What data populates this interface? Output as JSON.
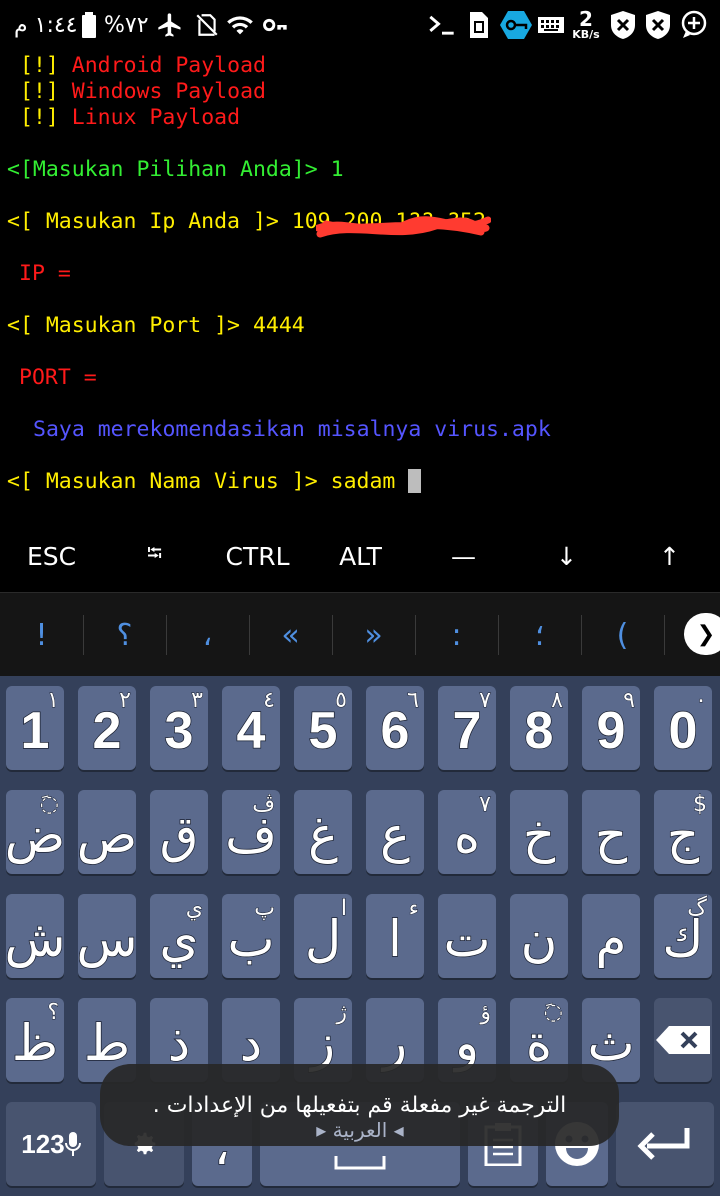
{
  "status_bar": {
    "time": "١:٤٤ م",
    "battery_percent": "%٧٢",
    "net_speed_value": "2",
    "net_speed_unit": "KB/s",
    "icons_left": [
      "battery-icon",
      "airplane-icon",
      "no-sim-icon",
      "wifi-icon",
      "key-icon"
    ],
    "icons_right": [
      "terminal-icon",
      "sim-card-icon",
      "vpn-key-icon",
      "keyboard-icon",
      "blocked-icon",
      "blocked-icon",
      "add-circle-icon"
    ]
  },
  "terminal": {
    "lines": [
      {
        "bracket": "[!]",
        "text": "Android Payload"
      },
      {
        "bracket": "[!]",
        "text": "Windows Payload"
      },
      {
        "bracket": "[!]",
        "text": "Linux Payload"
      }
    ],
    "prompt_choice": "<[Masukan Pilihan Anda]>",
    "choice_value": "1",
    "prompt_ip": "<[ Masukan Ip Anda ]>",
    "ip_value": "109.200.1??.?52",
    "ip_echo": "IP =",
    "prompt_port": "<[ Masukan Port ]>",
    "port_value": "4444",
    "port_echo": "PORT =",
    "recommendation": "Saya merekomendasikan misalnya virus.apk",
    "prompt_virus": "<[ Masukan Nama Virus ]>",
    "virus_value": "sadam"
  },
  "extra_keys": [
    "ESC",
    "⭾",
    "CTRL",
    "ALT",
    "—",
    "↓",
    "↑"
  ],
  "suggestions": [
    "!",
    "؟",
    "،",
    "«",
    "»",
    ":",
    "؛",
    "("
  ],
  "suggest_expand": "❯",
  "keyboard": {
    "row1": [
      {
        "main": "1",
        "hint": "١"
      },
      {
        "main": "2",
        "hint": "٢"
      },
      {
        "main": "3",
        "hint": "٣"
      },
      {
        "main": "4",
        "hint": "٤"
      },
      {
        "main": "5",
        "hint": "٥"
      },
      {
        "main": "6",
        "hint": "٦"
      },
      {
        "main": "7",
        "hint": "٧"
      },
      {
        "main": "8",
        "hint": "٨"
      },
      {
        "main": "9",
        "hint": "٩"
      },
      {
        "main": "0",
        "hint": "٠"
      }
    ],
    "row2": [
      {
        "main": "ض",
        "hint": "◌َ"
      },
      {
        "main": "ص",
        "hint": ""
      },
      {
        "main": "ق",
        "hint": ""
      },
      {
        "main": "ف",
        "hint": "ڤ"
      },
      {
        "main": "غ",
        "hint": ""
      },
      {
        "main": "ع",
        "hint": ""
      },
      {
        "main": "ه",
        "hint": "٧"
      },
      {
        "main": "خ",
        "hint": ""
      },
      {
        "main": "ح",
        "hint": ""
      },
      {
        "main": "ج",
        "hint": "$"
      }
    ],
    "row3": [
      {
        "main": "ش",
        "hint": ""
      },
      {
        "main": "س",
        "hint": ""
      },
      {
        "main": "ي",
        "hint": "ي"
      },
      {
        "main": "ب",
        "hint": "پ"
      },
      {
        "main": "ل",
        "hint": "ا"
      },
      {
        "main": "ا",
        "hint": "ء"
      },
      {
        "main": "ت",
        "hint": ""
      },
      {
        "main": "ن",
        "hint": ""
      },
      {
        "main": "م",
        "hint": ""
      },
      {
        "main": "ك",
        "hint": "گ"
      }
    ],
    "row4": [
      {
        "main": "ظ",
        "hint": "؟"
      },
      {
        "main": "ط",
        "hint": ""
      },
      {
        "main": "ذ",
        "hint": ""
      },
      {
        "main": "د",
        "hint": ""
      },
      {
        "main": "ز",
        "hint": "ژ"
      },
      {
        "main": "ر",
        "hint": ""
      },
      {
        "main": "و",
        "hint": "ؤ"
      },
      {
        "main": "ة",
        "hint": "◌َ"
      },
      {
        "main": "ث",
        "hint": ""
      }
    ],
    "key_numbers": "123",
    "key_comma": "،",
    "language": "العربية",
    "toast": "الترجمة غير مفعلة قم بتفعيلها من الإعدادات ."
  }
}
